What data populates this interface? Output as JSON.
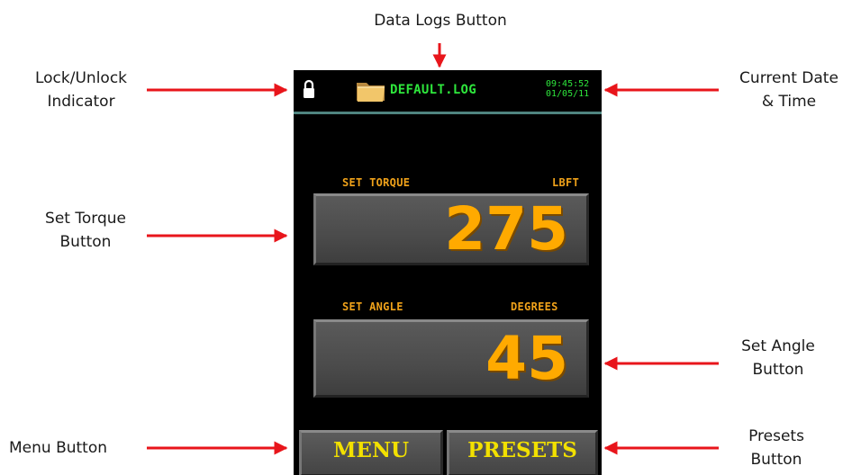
{
  "callouts": {
    "data_logs": "Data Logs Button",
    "lock_line1": "Lock/Unlock",
    "lock_line2": "Indicator",
    "datetime_line1": "Current Date",
    "datetime_line2": "& Time",
    "torque_line1": "Set Torque",
    "torque_line2": "Button",
    "angle_line1": "Set Angle",
    "angle_line2": "Button",
    "menu": "Menu Button",
    "presets_line1": "Presets",
    "presets_line2": "Button"
  },
  "device": {
    "log_file": "DEFAULT.LOG",
    "time": "09:45:52",
    "date": "01/05/11",
    "torque": {
      "label": "SET TORQUE",
      "unit": "LBFT",
      "value": "275"
    },
    "angle": {
      "label": "SET ANGLE",
      "unit": "DEGREES",
      "value": "45"
    },
    "menu_label": "MENU",
    "presets_label": "PRESETS"
  },
  "colors": {
    "arrow": "#e8151b",
    "status_text": "#2ee63c",
    "field_label": "#f0a21a",
    "value_digits": "#ffaa00",
    "soft_button_text": "#f2e000",
    "status_rule": "#4f8480"
  },
  "icons": [
    "lock-icon",
    "folder-icon"
  ]
}
